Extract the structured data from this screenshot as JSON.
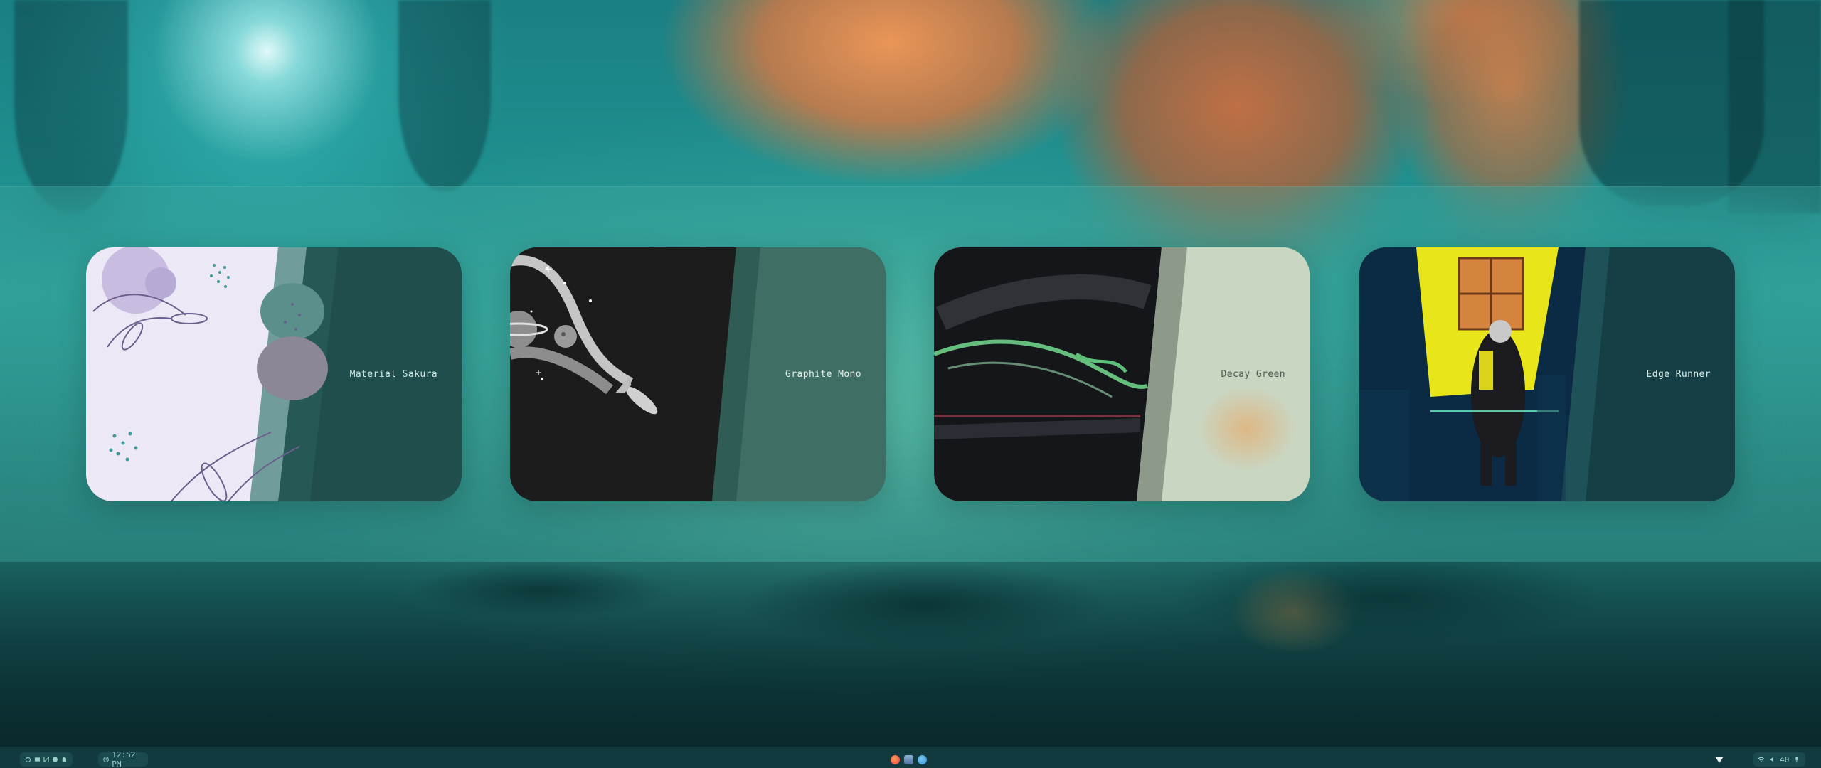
{
  "taskbar": {
    "clock": "12:52 PM",
    "workspace_icons": [
      "power-icon",
      "terminal-icon",
      "window-icon",
      "palette-icon",
      "ghost-icon"
    ],
    "tray": {
      "volume": "40",
      "icons": [
        "notification-icon",
        "wifi-icon",
        "volume-icon",
        "mic-icon"
      ]
    },
    "apps": [
      "firefox-icon",
      "files-icon",
      "telegram-icon"
    ]
  },
  "themes": [
    {
      "label": "Material Sakura",
      "colors": {
        "preview_bg": "#ece8f5",
        "panel": "#1f4e4c",
        "text": "#cfe9e4"
      }
    },
    {
      "label": "Graphite Mono",
      "colors": {
        "preview_bg": "#1c1c1c",
        "panel": "#3f6e64",
        "text": "#e2efe9"
      }
    },
    {
      "label": "Decay Green",
      "colors": {
        "preview_bg": "#15161a",
        "panel": "#c9d6c2",
        "text": "#4d5a52"
      }
    },
    {
      "label": "Edge Runner",
      "colors": {
        "preview_bg": "#0b2a44",
        "panel": "#163f45",
        "text": "#d8eee9"
      }
    }
  ]
}
